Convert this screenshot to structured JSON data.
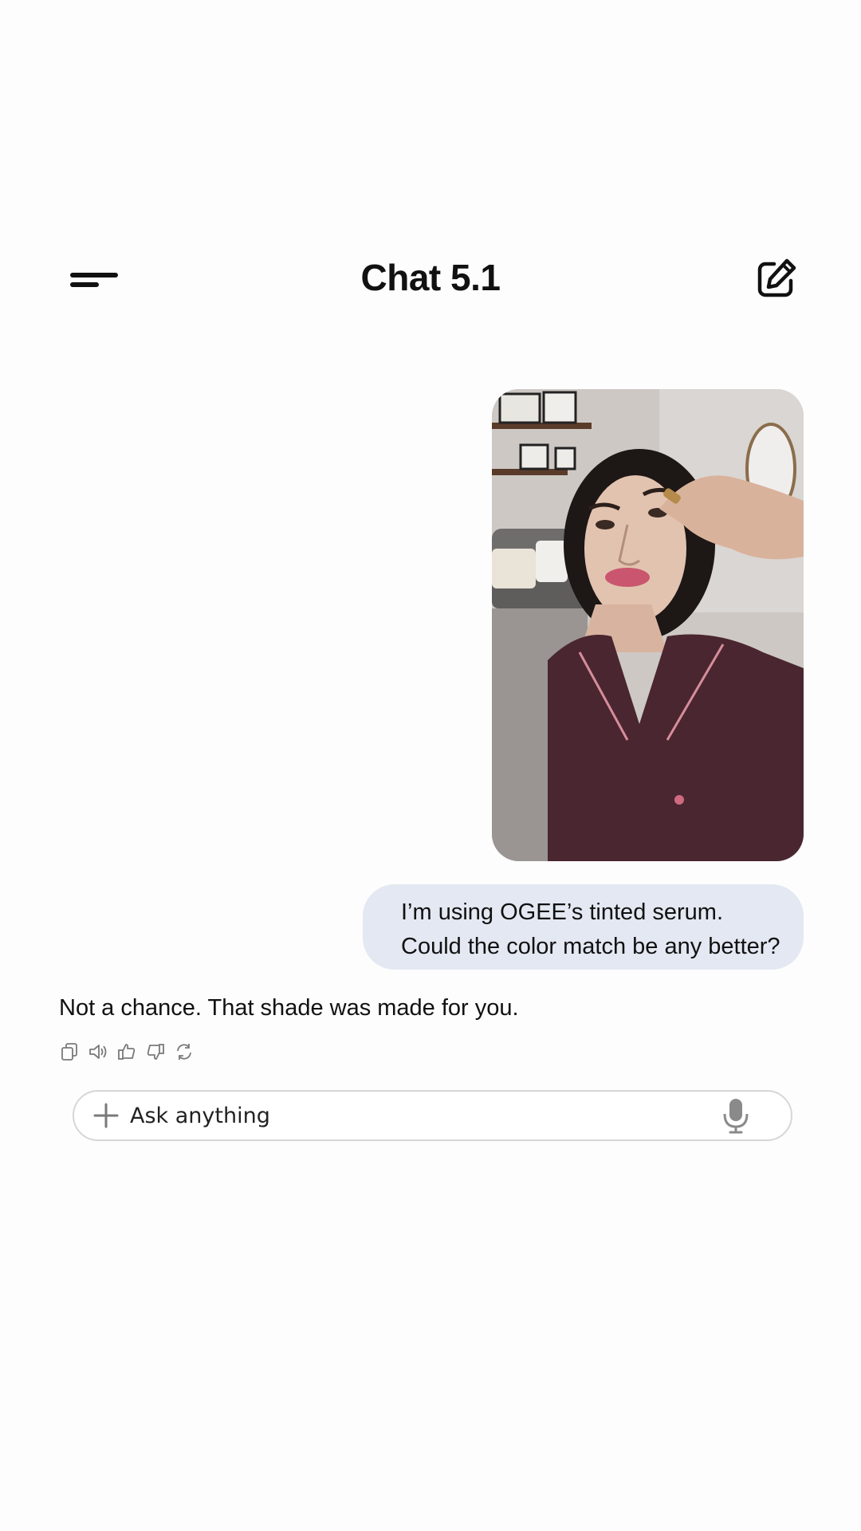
{
  "header": {
    "title": "Chat 5.1",
    "menu_icon": "hamburger-menu-icon",
    "new_chat_icon": "compose-edit-icon"
  },
  "conversation": {
    "user_photo": {
      "subject": "selfie"
    },
    "user_message_lines": [
      "I’m using OGEE’s tinted serum.",
      "Could the color match be any better?"
    ],
    "assistant_message": "Not a chance. That shade was made for you.",
    "assistant_actions": [
      {
        "icon": "copy-icon"
      },
      {
        "icon": "speaker-icon"
      },
      {
        "icon": "thumbs-up-icon"
      },
      {
        "icon": "thumbs-down-icon"
      },
      {
        "icon": "regenerate-icon"
      }
    ]
  },
  "composer": {
    "placeholder": "Ask anything",
    "value": "",
    "plus_icon": "plus-icon",
    "mic_icon": "microphone-icon"
  },
  "colors": {
    "background": "#fdfdfd",
    "user_bubble": "#e3e8f2",
    "text": "#111111",
    "input_border": "#d6d6d6",
    "icon_gray": "#7a7a7a"
  }
}
